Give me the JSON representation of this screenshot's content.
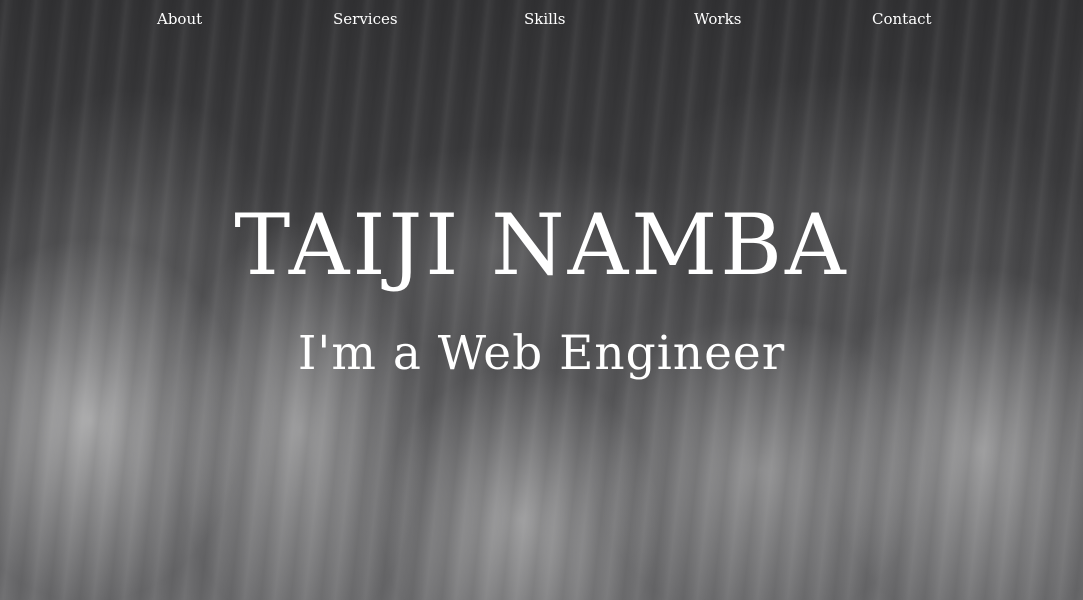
{
  "nav": {
    "items": [
      {
        "label": "About"
      },
      {
        "label": "Services"
      },
      {
        "label": "Skills"
      },
      {
        "label": "Works"
      },
      {
        "label": "Contact"
      }
    ]
  },
  "hero": {
    "title": "TAIJI NAMBA",
    "subtitle": "I'm a Web Engineer"
  },
  "colors": {
    "text": "#ffffff",
    "background": "#3a3a3c"
  }
}
